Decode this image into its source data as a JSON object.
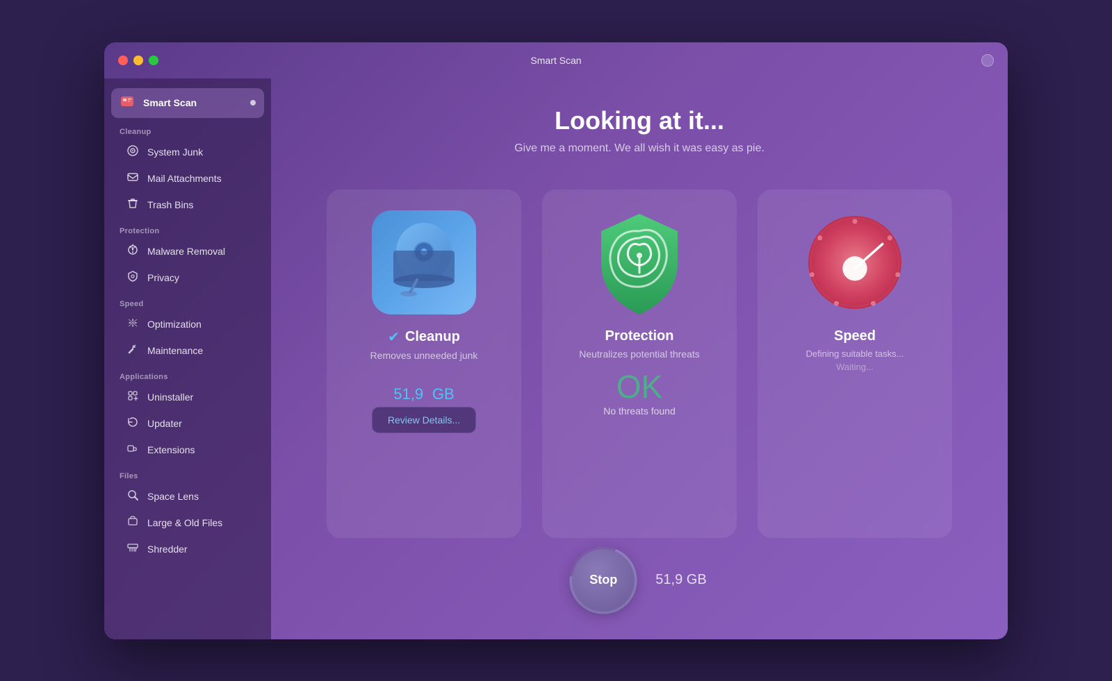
{
  "window": {
    "title": "Smart Scan"
  },
  "sidebar": {
    "active_item": "Smart Scan",
    "active_item_icon": "🛡",
    "sections": [
      {
        "label": "Cleanup",
        "items": [
          {
            "id": "system-junk",
            "label": "System Junk",
            "icon": "💿"
          },
          {
            "id": "mail-attachments",
            "label": "Mail Attachments",
            "icon": "✉"
          },
          {
            "id": "trash-bins",
            "label": "Trash Bins",
            "icon": "🗑"
          }
        ]
      },
      {
        "label": "Protection",
        "items": [
          {
            "id": "malware-removal",
            "label": "Malware Removal",
            "icon": "☣"
          },
          {
            "id": "privacy",
            "label": "Privacy",
            "icon": "🤚"
          }
        ]
      },
      {
        "label": "Speed",
        "items": [
          {
            "id": "optimization",
            "label": "Optimization",
            "icon": "⚙"
          },
          {
            "id": "maintenance",
            "label": "Maintenance",
            "icon": "🔧"
          }
        ]
      },
      {
        "label": "Applications",
        "items": [
          {
            "id": "uninstaller",
            "label": "Uninstaller",
            "icon": "🗂"
          },
          {
            "id": "updater",
            "label": "Updater",
            "icon": "🔄"
          },
          {
            "id": "extensions",
            "label": "Extensions",
            "icon": "🔌"
          }
        ]
      },
      {
        "label": "Files",
        "items": [
          {
            "id": "space-lens",
            "label": "Space Lens",
            "icon": "🔍"
          },
          {
            "id": "large-old-files",
            "label": "Large & Old Files",
            "icon": "📁"
          },
          {
            "id": "shredder",
            "label": "Shredder",
            "icon": "🖨"
          }
        ]
      }
    ]
  },
  "main": {
    "heading": "Looking at it...",
    "subheading": "Give me a moment. We all wish it was easy as pie.",
    "cards": [
      {
        "id": "cleanup",
        "title": "Cleanup",
        "has_check": true,
        "description": "Removes unneeded junk",
        "value": "51,9",
        "value_unit": "GB",
        "status": null,
        "button_label": "Review Details...",
        "extra": null
      },
      {
        "id": "protection",
        "title": "Protection",
        "has_check": false,
        "description": "Neutralizes potential threats",
        "value": "OK",
        "value_unit": null,
        "status": "No threats found",
        "button_label": null,
        "extra": null
      },
      {
        "id": "speed",
        "title": "Speed",
        "has_check": false,
        "description": "Defining suitable tasks...",
        "value": null,
        "value_unit": null,
        "status": "Waiting...",
        "button_label": null,
        "extra": null
      }
    ],
    "stop_button_label": "Stop",
    "stop_value": "51,9 GB"
  }
}
